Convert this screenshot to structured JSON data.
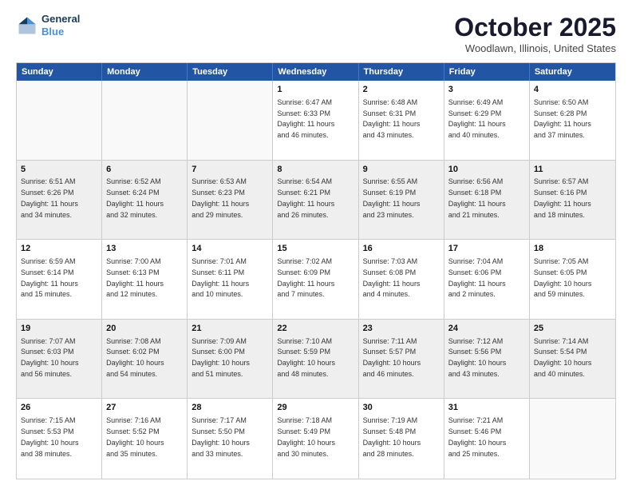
{
  "header": {
    "logo_line1": "General",
    "logo_line2": "Blue",
    "month": "October 2025",
    "location": "Woodlawn, Illinois, United States"
  },
  "weekdays": [
    "Sunday",
    "Monday",
    "Tuesday",
    "Wednesday",
    "Thursday",
    "Friday",
    "Saturday"
  ],
  "rows": [
    [
      {
        "day": "",
        "text": "",
        "empty": true
      },
      {
        "day": "",
        "text": "",
        "empty": true
      },
      {
        "day": "",
        "text": "",
        "empty": true
      },
      {
        "day": "1",
        "text": "Sunrise: 6:47 AM\nSunset: 6:33 PM\nDaylight: 11 hours\nand 46 minutes.",
        "empty": false
      },
      {
        "day": "2",
        "text": "Sunrise: 6:48 AM\nSunset: 6:31 PM\nDaylight: 11 hours\nand 43 minutes.",
        "empty": false
      },
      {
        "day": "3",
        "text": "Sunrise: 6:49 AM\nSunset: 6:29 PM\nDaylight: 11 hours\nand 40 minutes.",
        "empty": false
      },
      {
        "day": "4",
        "text": "Sunrise: 6:50 AM\nSunset: 6:28 PM\nDaylight: 11 hours\nand 37 minutes.",
        "empty": false
      }
    ],
    [
      {
        "day": "5",
        "text": "Sunrise: 6:51 AM\nSunset: 6:26 PM\nDaylight: 11 hours\nand 34 minutes.",
        "empty": false,
        "shaded": true
      },
      {
        "day": "6",
        "text": "Sunrise: 6:52 AM\nSunset: 6:24 PM\nDaylight: 11 hours\nand 32 minutes.",
        "empty": false,
        "shaded": true
      },
      {
        "day": "7",
        "text": "Sunrise: 6:53 AM\nSunset: 6:23 PM\nDaylight: 11 hours\nand 29 minutes.",
        "empty": false,
        "shaded": true
      },
      {
        "day": "8",
        "text": "Sunrise: 6:54 AM\nSunset: 6:21 PM\nDaylight: 11 hours\nand 26 minutes.",
        "empty": false,
        "shaded": true
      },
      {
        "day": "9",
        "text": "Sunrise: 6:55 AM\nSunset: 6:19 PM\nDaylight: 11 hours\nand 23 minutes.",
        "empty": false,
        "shaded": true
      },
      {
        "day": "10",
        "text": "Sunrise: 6:56 AM\nSunset: 6:18 PM\nDaylight: 11 hours\nand 21 minutes.",
        "empty": false,
        "shaded": true
      },
      {
        "day": "11",
        "text": "Sunrise: 6:57 AM\nSunset: 6:16 PM\nDaylight: 11 hours\nand 18 minutes.",
        "empty": false,
        "shaded": true
      }
    ],
    [
      {
        "day": "12",
        "text": "Sunrise: 6:59 AM\nSunset: 6:14 PM\nDaylight: 11 hours\nand 15 minutes.",
        "empty": false
      },
      {
        "day": "13",
        "text": "Sunrise: 7:00 AM\nSunset: 6:13 PM\nDaylight: 11 hours\nand 12 minutes.",
        "empty": false
      },
      {
        "day": "14",
        "text": "Sunrise: 7:01 AM\nSunset: 6:11 PM\nDaylight: 11 hours\nand 10 minutes.",
        "empty": false
      },
      {
        "day": "15",
        "text": "Sunrise: 7:02 AM\nSunset: 6:09 PM\nDaylight: 11 hours\nand 7 minutes.",
        "empty": false
      },
      {
        "day": "16",
        "text": "Sunrise: 7:03 AM\nSunset: 6:08 PM\nDaylight: 11 hours\nand 4 minutes.",
        "empty": false
      },
      {
        "day": "17",
        "text": "Sunrise: 7:04 AM\nSunset: 6:06 PM\nDaylight: 11 hours\nand 2 minutes.",
        "empty": false
      },
      {
        "day": "18",
        "text": "Sunrise: 7:05 AM\nSunset: 6:05 PM\nDaylight: 10 hours\nand 59 minutes.",
        "empty": false
      }
    ],
    [
      {
        "day": "19",
        "text": "Sunrise: 7:07 AM\nSunset: 6:03 PM\nDaylight: 10 hours\nand 56 minutes.",
        "empty": false,
        "shaded": true
      },
      {
        "day": "20",
        "text": "Sunrise: 7:08 AM\nSunset: 6:02 PM\nDaylight: 10 hours\nand 54 minutes.",
        "empty": false,
        "shaded": true
      },
      {
        "day": "21",
        "text": "Sunrise: 7:09 AM\nSunset: 6:00 PM\nDaylight: 10 hours\nand 51 minutes.",
        "empty": false,
        "shaded": true
      },
      {
        "day": "22",
        "text": "Sunrise: 7:10 AM\nSunset: 5:59 PM\nDaylight: 10 hours\nand 48 minutes.",
        "empty": false,
        "shaded": true
      },
      {
        "day": "23",
        "text": "Sunrise: 7:11 AM\nSunset: 5:57 PM\nDaylight: 10 hours\nand 46 minutes.",
        "empty": false,
        "shaded": true
      },
      {
        "day": "24",
        "text": "Sunrise: 7:12 AM\nSunset: 5:56 PM\nDaylight: 10 hours\nand 43 minutes.",
        "empty": false,
        "shaded": true
      },
      {
        "day": "25",
        "text": "Sunrise: 7:14 AM\nSunset: 5:54 PM\nDaylight: 10 hours\nand 40 minutes.",
        "empty": false,
        "shaded": true
      }
    ],
    [
      {
        "day": "26",
        "text": "Sunrise: 7:15 AM\nSunset: 5:53 PM\nDaylight: 10 hours\nand 38 minutes.",
        "empty": false
      },
      {
        "day": "27",
        "text": "Sunrise: 7:16 AM\nSunset: 5:52 PM\nDaylight: 10 hours\nand 35 minutes.",
        "empty": false
      },
      {
        "day": "28",
        "text": "Sunrise: 7:17 AM\nSunset: 5:50 PM\nDaylight: 10 hours\nand 33 minutes.",
        "empty": false
      },
      {
        "day": "29",
        "text": "Sunrise: 7:18 AM\nSunset: 5:49 PM\nDaylight: 10 hours\nand 30 minutes.",
        "empty": false
      },
      {
        "day": "30",
        "text": "Sunrise: 7:19 AM\nSunset: 5:48 PM\nDaylight: 10 hours\nand 28 minutes.",
        "empty": false
      },
      {
        "day": "31",
        "text": "Sunrise: 7:21 AM\nSunset: 5:46 PM\nDaylight: 10 hours\nand 25 minutes.",
        "empty": false
      },
      {
        "day": "",
        "text": "",
        "empty": true
      }
    ]
  ]
}
